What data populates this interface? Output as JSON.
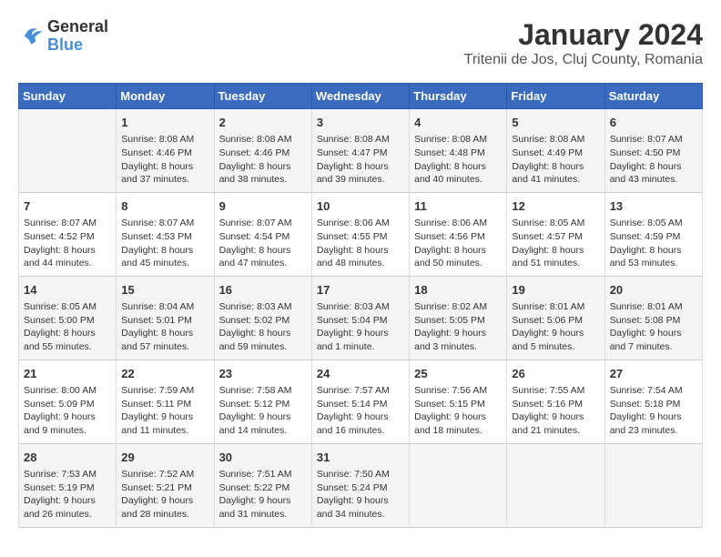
{
  "header": {
    "logo_line1": "General",
    "logo_line2": "Blue",
    "title": "January 2024",
    "subtitle": "Tritenii de Jos, Cluj County, Romania"
  },
  "weekdays": [
    "Sunday",
    "Monday",
    "Tuesday",
    "Wednesday",
    "Thursday",
    "Friday",
    "Saturday"
  ],
  "weeks": [
    [
      {
        "day": "",
        "info": ""
      },
      {
        "day": "1",
        "info": "Sunrise: 8:08 AM\nSunset: 4:46 PM\nDaylight: 8 hours\nand 37 minutes."
      },
      {
        "day": "2",
        "info": "Sunrise: 8:08 AM\nSunset: 4:46 PM\nDaylight: 8 hours\nand 38 minutes."
      },
      {
        "day": "3",
        "info": "Sunrise: 8:08 AM\nSunset: 4:47 PM\nDaylight: 8 hours\nand 39 minutes."
      },
      {
        "day": "4",
        "info": "Sunrise: 8:08 AM\nSunset: 4:48 PM\nDaylight: 8 hours\nand 40 minutes."
      },
      {
        "day": "5",
        "info": "Sunrise: 8:08 AM\nSunset: 4:49 PM\nDaylight: 8 hours\nand 41 minutes."
      },
      {
        "day": "6",
        "info": "Sunrise: 8:07 AM\nSunset: 4:50 PM\nDaylight: 8 hours\nand 43 minutes."
      }
    ],
    [
      {
        "day": "7",
        "info": "Sunrise: 8:07 AM\nSunset: 4:52 PM\nDaylight: 8 hours\nand 44 minutes."
      },
      {
        "day": "8",
        "info": "Sunrise: 8:07 AM\nSunset: 4:53 PM\nDaylight: 8 hours\nand 45 minutes."
      },
      {
        "day": "9",
        "info": "Sunrise: 8:07 AM\nSunset: 4:54 PM\nDaylight: 8 hours\nand 47 minutes."
      },
      {
        "day": "10",
        "info": "Sunrise: 8:06 AM\nSunset: 4:55 PM\nDaylight: 8 hours\nand 48 minutes."
      },
      {
        "day": "11",
        "info": "Sunrise: 8:06 AM\nSunset: 4:56 PM\nDaylight: 8 hours\nand 50 minutes."
      },
      {
        "day": "12",
        "info": "Sunrise: 8:05 AM\nSunset: 4:57 PM\nDaylight: 8 hours\nand 51 minutes."
      },
      {
        "day": "13",
        "info": "Sunrise: 8:05 AM\nSunset: 4:59 PM\nDaylight: 8 hours\nand 53 minutes."
      }
    ],
    [
      {
        "day": "14",
        "info": "Sunrise: 8:05 AM\nSunset: 5:00 PM\nDaylight: 8 hours\nand 55 minutes."
      },
      {
        "day": "15",
        "info": "Sunrise: 8:04 AM\nSunset: 5:01 PM\nDaylight: 8 hours\nand 57 minutes."
      },
      {
        "day": "16",
        "info": "Sunrise: 8:03 AM\nSunset: 5:02 PM\nDaylight: 8 hours\nand 59 minutes."
      },
      {
        "day": "17",
        "info": "Sunrise: 8:03 AM\nSunset: 5:04 PM\nDaylight: 9 hours\nand 1 minute."
      },
      {
        "day": "18",
        "info": "Sunrise: 8:02 AM\nSunset: 5:05 PM\nDaylight: 9 hours\nand 3 minutes."
      },
      {
        "day": "19",
        "info": "Sunrise: 8:01 AM\nSunset: 5:06 PM\nDaylight: 9 hours\nand 5 minutes."
      },
      {
        "day": "20",
        "info": "Sunrise: 8:01 AM\nSunset: 5:08 PM\nDaylight: 9 hours\nand 7 minutes."
      }
    ],
    [
      {
        "day": "21",
        "info": "Sunrise: 8:00 AM\nSunset: 5:09 PM\nDaylight: 9 hours\nand 9 minutes."
      },
      {
        "day": "22",
        "info": "Sunrise: 7:59 AM\nSunset: 5:11 PM\nDaylight: 9 hours\nand 11 minutes."
      },
      {
        "day": "23",
        "info": "Sunrise: 7:58 AM\nSunset: 5:12 PM\nDaylight: 9 hours\nand 14 minutes."
      },
      {
        "day": "24",
        "info": "Sunrise: 7:57 AM\nSunset: 5:14 PM\nDaylight: 9 hours\nand 16 minutes."
      },
      {
        "day": "25",
        "info": "Sunrise: 7:56 AM\nSunset: 5:15 PM\nDaylight: 9 hours\nand 18 minutes."
      },
      {
        "day": "26",
        "info": "Sunrise: 7:55 AM\nSunset: 5:16 PM\nDaylight: 9 hours\nand 21 minutes."
      },
      {
        "day": "27",
        "info": "Sunrise: 7:54 AM\nSunset: 5:18 PM\nDaylight: 9 hours\nand 23 minutes."
      }
    ],
    [
      {
        "day": "28",
        "info": "Sunrise: 7:53 AM\nSunset: 5:19 PM\nDaylight: 9 hours\nand 26 minutes."
      },
      {
        "day": "29",
        "info": "Sunrise: 7:52 AM\nSunset: 5:21 PM\nDaylight: 9 hours\nand 28 minutes."
      },
      {
        "day": "30",
        "info": "Sunrise: 7:51 AM\nSunset: 5:22 PM\nDaylight: 9 hours\nand 31 minutes."
      },
      {
        "day": "31",
        "info": "Sunrise: 7:50 AM\nSunset: 5:24 PM\nDaylight: 9 hours\nand 34 minutes."
      },
      {
        "day": "",
        "info": ""
      },
      {
        "day": "",
        "info": ""
      },
      {
        "day": "",
        "info": ""
      }
    ]
  ]
}
